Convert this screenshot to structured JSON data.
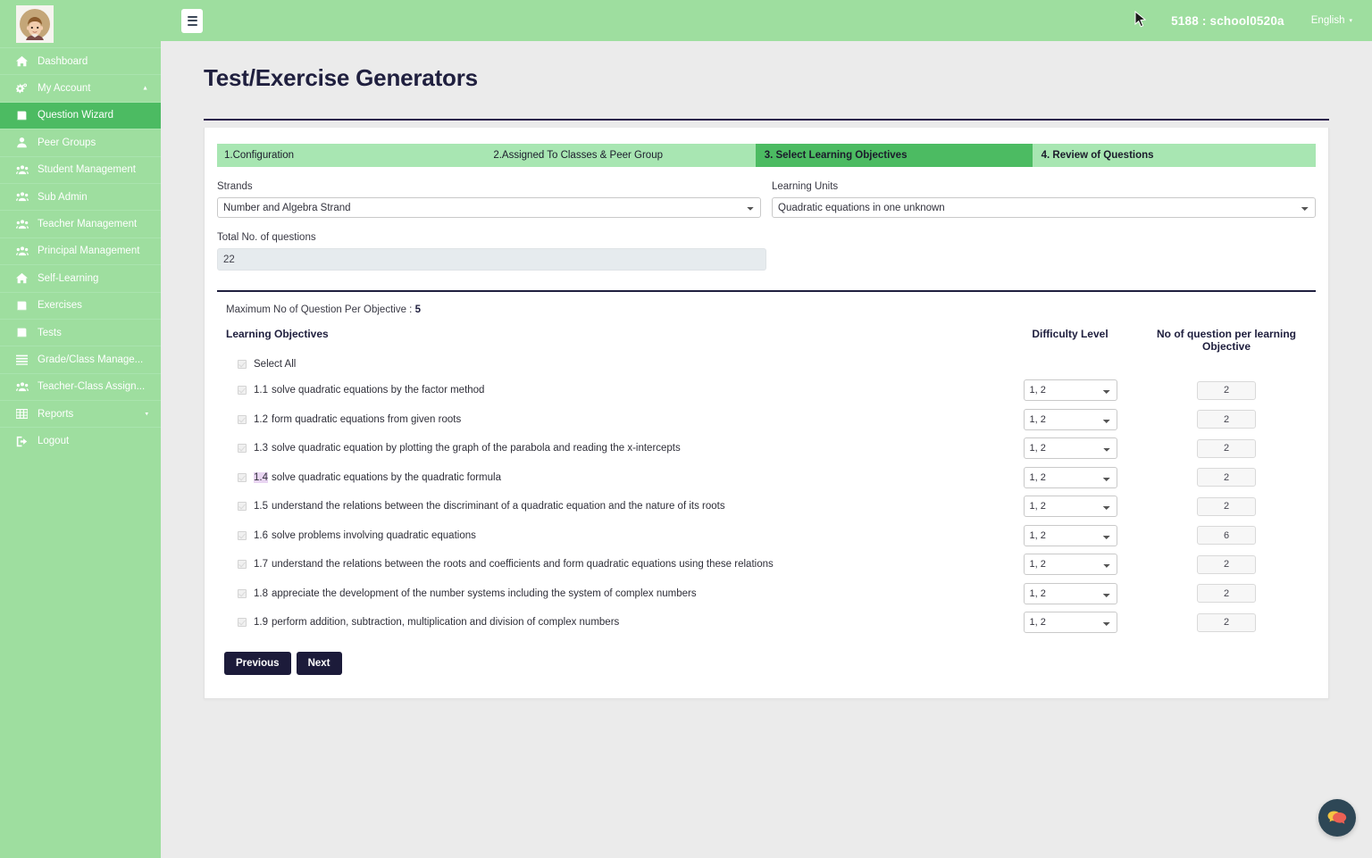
{
  "sidebar": {
    "avatar_name": "user-avatar",
    "items": [
      {
        "label": "Dashboard",
        "icon": "home-icon",
        "active": false,
        "caret": ""
      },
      {
        "label": "My Account",
        "icon": "gears-icon",
        "active": false,
        "caret": "▲"
      },
      {
        "label": "Question Wizard",
        "icon": "book-icon",
        "active": true,
        "caret": ""
      },
      {
        "label": "Peer Groups",
        "icon": "user-icon",
        "active": false,
        "caret": ""
      },
      {
        "label": "Student Management",
        "icon": "users-icon",
        "active": false,
        "caret": ""
      },
      {
        "label": "Sub Admin",
        "icon": "users-icon",
        "active": false,
        "caret": ""
      },
      {
        "label": "Teacher Management",
        "icon": "users-icon",
        "active": false,
        "caret": ""
      },
      {
        "label": "Principal Management",
        "icon": "users-icon",
        "active": false,
        "caret": ""
      },
      {
        "label": "Self-Learning",
        "icon": "home-icon",
        "active": false,
        "caret": ""
      },
      {
        "label": "Exercises",
        "icon": "book-icon",
        "active": false,
        "caret": ""
      },
      {
        "label": "Tests",
        "icon": "book-icon",
        "active": false,
        "caret": ""
      },
      {
        "label": "Grade/Class Manage...",
        "icon": "list-icon",
        "active": false,
        "caret": ""
      },
      {
        "label": "Teacher-Class Assign...",
        "icon": "users-icon",
        "active": false,
        "caret": ""
      },
      {
        "label": "Reports",
        "icon": "table-icon",
        "active": false,
        "caret": "▾"
      },
      {
        "label": "Logout",
        "icon": "logout-icon",
        "active": false,
        "caret": ""
      }
    ]
  },
  "topbar": {
    "menu_toggle": "hamburger-icon",
    "school_id": "5188 : school0520a",
    "language": "English",
    "language_caret": "▾"
  },
  "page": {
    "title": "Test/Exercise Generators"
  },
  "steps": [
    {
      "label": "1.Configuration",
      "active": false
    },
    {
      "label": "2.Assigned To Classes & Peer Group",
      "active": false
    },
    {
      "label": "3. Select Learning Objectives",
      "active": true
    },
    {
      "label": "4. Review of Questions",
      "active": false
    }
  ],
  "form": {
    "strands_label": "Strands",
    "strands_value": "Number and Algebra Strand",
    "learning_units_label": "Learning Units",
    "learning_units_value": "Quadratic equations in one unknown",
    "total_label": "Total No. of questions",
    "total_value": "22",
    "max_note_prefix": "Maximum No of Question Per Objective : ",
    "max_note_value": "5"
  },
  "table": {
    "col_objectives": "Learning Objectives",
    "col_difficulty": "Difficulty Level",
    "col_number": "No of question per learning Objective",
    "select_all_label": "Select All",
    "rows": [
      {
        "code": "1.1",
        "text": "solve quadratic equations by the factor method",
        "difficulty": "1, 2",
        "count": "2",
        "highlight": false
      },
      {
        "code": "1.2",
        "text": "form quadratic equations from given roots",
        "difficulty": "1, 2",
        "count": "2",
        "highlight": false
      },
      {
        "code": "1.3",
        "text": "solve quadratic equation by plotting the graph of the parabola and reading the x-intercepts",
        "difficulty": "1, 2",
        "count": "2",
        "highlight": false
      },
      {
        "code": "1.4",
        "text": "solve quadratic equations by the quadratic formula",
        "difficulty": "1, 2",
        "count": "2",
        "highlight": true
      },
      {
        "code": "1.5",
        "text": "understand the relations between the discriminant of a quadratic equation and the nature of its roots",
        "difficulty": "1, 2",
        "count": "2",
        "highlight": false
      },
      {
        "code": "1.6",
        "text": "solve problems involving quadratic equations",
        "difficulty": "1, 2",
        "count": "6",
        "highlight": false
      },
      {
        "code": "1.7",
        "text": "understand the relations between the roots and coefficients and form quadratic equations using these relations",
        "difficulty": "1, 2",
        "count": "2",
        "highlight": false
      },
      {
        "code": "1.8",
        "text": "appreciate the development of the number systems including the system of complex numbers",
        "difficulty": "1, 2",
        "count": "2",
        "highlight": false
      },
      {
        "code": "1.9",
        "text": "perform addition, subtraction, multiplication and division of complex numbers",
        "difficulty": "1, 2",
        "count": "2",
        "highlight": false
      }
    ]
  },
  "buttons": {
    "previous": "Previous",
    "next": "Next"
  },
  "chat": {
    "name": "chat-bubble-icon"
  },
  "colors": {
    "sidebar_green": "#9ede9f",
    "active_green": "#4cbb62",
    "step_green": "#a8e6b2",
    "dark_navy": "#1c1b3a",
    "page_bg": "#ebebeb",
    "selection_highlight": "#e9d5f2"
  }
}
